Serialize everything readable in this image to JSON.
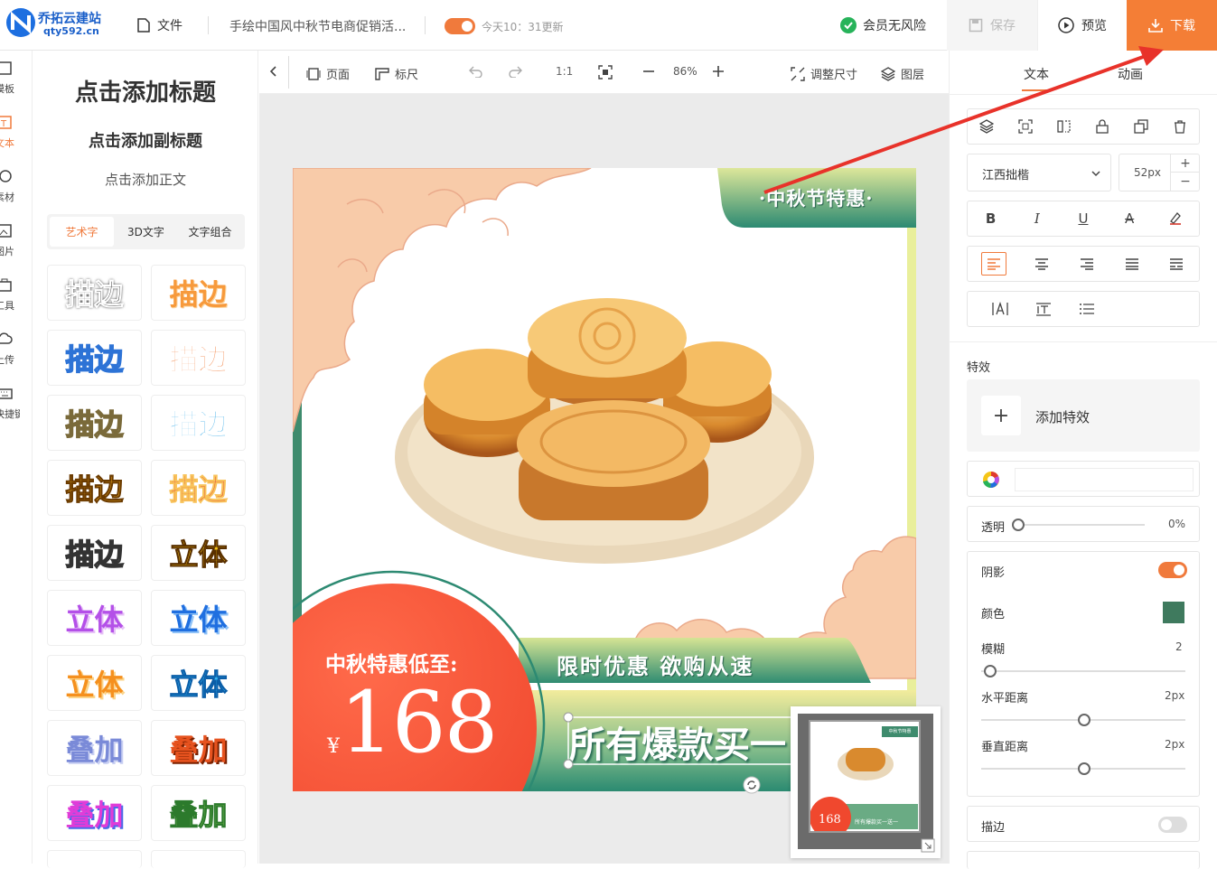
{
  "header": {
    "logo_name": "乔拓云建站",
    "logo_domain": "qty592.cn",
    "file_label": "文件",
    "doc_title": "手绘中国风中秋节电商促销活...",
    "update_text": "今天10：31更新",
    "vip_label": "会员无风险",
    "save_label": "保存",
    "preview_label": "预览",
    "download_label": "下载",
    "accent": "#f47e36"
  },
  "leftnav": {
    "items": [
      {
        "label": "模板",
        "icon": "template-icon"
      },
      {
        "label": "文本",
        "icon": "text-icon"
      },
      {
        "label": "素材",
        "icon": "material-icon"
      },
      {
        "label": "图片",
        "icon": "image-icon"
      },
      {
        "label": "工具",
        "icon": "tools-icon"
      },
      {
        "label": "上传",
        "icon": "upload-icon"
      },
      {
        "label": "快捷键",
        "icon": "keyboard-icon"
      }
    ]
  },
  "textpanel": {
    "add_title": "点击添加标题",
    "add_subtitle": "点击添加副标题",
    "add_body": "点击添加正文",
    "tabs": [
      "艺术字",
      "3D文字",
      "文字组合"
    ],
    "art_items": [
      "描边",
      "描边",
      "描边",
      "描边",
      "描边",
      "描边",
      "描边",
      "描边",
      "描边",
      "立体",
      "立体",
      "立体",
      "立体",
      "立体",
      "叠加",
      "叠加",
      "叠加",
      "叠加"
    ]
  },
  "canvas_toolbar": {
    "page_label": "页面",
    "ruler_label": "标尺",
    "ratio_label": "1:1",
    "zoom": "86%",
    "resize_label": "调整尺寸",
    "layers_label": "图层"
  },
  "design": {
    "badge": "·中秋节特惠·",
    "promo_label": "中秋特惠低至:",
    "currency": "¥",
    "price": "168",
    "slogan": "限时优惠 欲购从速",
    "headline": "所有爆款买一"
  },
  "minimap": {
    "badge": "中秋节特惠",
    "price": "168",
    "headline": "所有爆款买一送一"
  },
  "rightpanel": {
    "tabs": [
      "文本",
      "动画"
    ],
    "font": "江西拙楷",
    "font_size": "52px",
    "effects_label": "特效",
    "add_effect_label": "添加特效",
    "opacity_label": "透明",
    "opacity_value": "0%",
    "opacity_level": 0,
    "shadow_label": "阴影",
    "shadow_color_label": "颜色",
    "shadow_color": "#3f7a5e",
    "blur_label": "模糊",
    "blur_value": "2",
    "hoffset_label": "水平距离",
    "hoffset_value": "2px",
    "voffset_label": "垂直距离",
    "voffset_value": "2px",
    "stroke_label": "描边"
  }
}
